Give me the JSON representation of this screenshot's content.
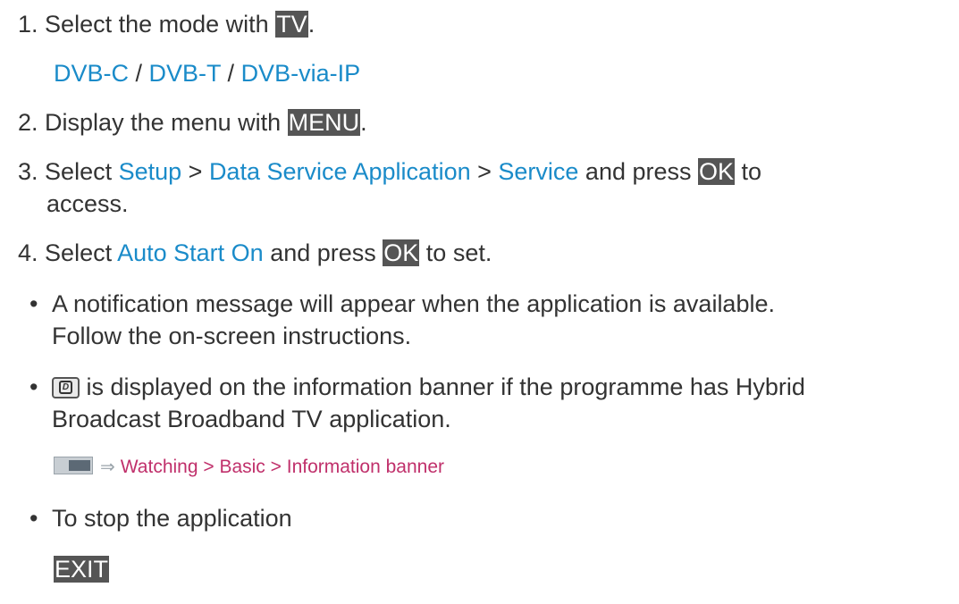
{
  "step1": {
    "num": "1.",
    "text": "Select the mode with ",
    "key": "TV",
    "end": "."
  },
  "modes": {
    "dvbc": "DVB-C",
    "sep1": " / ",
    "dvbt": "DVB-T",
    "sep2": " / ",
    "dvbip": "DVB-via-IP"
  },
  "step2": {
    "num": "2.",
    "text": "Display the menu with ",
    "key": "MENU",
    "end": "."
  },
  "step3": {
    "num": "3.",
    "text": "Select ",
    "setup": "Setup",
    "gt1": " > ",
    "dsa": "Data Service Application",
    "gt2": " > ",
    "service": "Service",
    "and": " and press ",
    "key": "OK",
    "to": " to",
    "line2": "access."
  },
  "step4": {
    "num": "4.",
    "text": "Select ",
    "option": "Auto Start On",
    "and": " and press ",
    "key": "OK",
    "end": " to set."
  },
  "bullet1": {
    "line1": "A notification message will appear when the application is available.",
    "line2": "Follow the on-screen instructions."
  },
  "bullet2": {
    "line1": " is displayed on the information banner if the programme has Hybrid",
    "line2": "Broadcast Broadband TV application."
  },
  "reference": {
    "path": "Watching > Basic > Information banner"
  },
  "bullet3": {
    "text": "To stop the application"
  },
  "exit_key": "EXIT",
  "bullet_char": "•",
  "icon_letter": "D",
  "icons": {
    "data_icon": "d-data-icon",
    "menu_icon": "menu-screen-icon",
    "arrow": "arrow-right-icon"
  },
  "colors": {
    "link_blue": "#1a8bc9",
    "ref_pink": "#c0306b",
    "key_bg": "#555555",
    "text": "#333333"
  }
}
